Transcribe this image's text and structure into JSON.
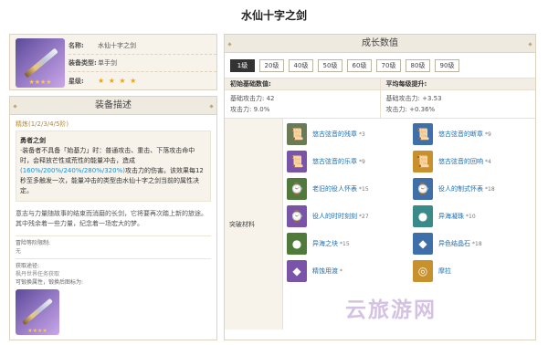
{
  "page": {
    "title": "水仙十字之剑"
  },
  "info": {
    "rows": [
      {
        "key": "名称:",
        "value": "水仙十字之剑"
      },
      {
        "key": "装备类型:",
        "value": "单手剑"
      },
      {
        "key": "星级:",
        "value": "★ ★ ★ ★"
      }
    ],
    "thumb_stars": "★★★★"
  },
  "desc": {
    "heading": "装备描述",
    "refine": "精炼(1/2/3/4/5阶)",
    "skill_name": "勇者之剑",
    "skill_text_1": "·装备者不具备「始基力」时：普通攻击、重击、下落攻击命中时，会释放芒性或荒性的能量冲击，造成",
    "skill_values": "(160%/200%/240%/280%/320%)",
    "skill_text_2": "攻击力的伤害。该效果每12秒至多触发一次，能量冲击的类型由水仙十字之剑当前的属性决定。",
    "flavor": "意志与力量随故事的结束而消磨的长剑，它将要再次踏上新的旅途。其中残余着一些力量，纪念着一场宏大的梦。",
    "fields": [
      {
        "label": "冒险等阶限制:",
        "value": "无"
      },
      {
        "label": "获取途径:",
        "value": "枫丹世界任务获取"
      },
      {
        "label": "可锻换属性，锻换后图标为:",
        "value": ""
      }
    ],
    "mini_stars": "★★★★"
  },
  "growth": {
    "heading": "成长数值",
    "levels": [
      "1级",
      "20级",
      "40级",
      "50级",
      "60级",
      "70级",
      "80级",
      "90级"
    ],
    "active_level": "1级",
    "initial_header": "初始基础数值:",
    "increase_header": "平均每级提升:",
    "initial": [
      "基础攻击力: 42",
      "攻击力: 9.0%"
    ],
    "increase": [
      "基础攻击力: +3.53",
      "攻击力: +0.36%"
    ],
    "materials_label": "突破材料",
    "materials": [
      {
        "name": "悠古弦音的残章",
        "count": "*3",
        "icon": "scroll-icon",
        "color": "#6b7a56"
      },
      {
        "name": "悠古弦音的断章",
        "count": "*9",
        "icon": "scroll-icon",
        "color": "#3f6fa8"
      },
      {
        "name": "悠古弦音的乐章",
        "count": "*9",
        "icon": "scroll-icon",
        "color": "#7a54a8"
      },
      {
        "name": "悠古弦音的回响",
        "count": "*4",
        "icon": "scroll-icon",
        "color": "#c9912e"
      },
      {
        "name": "老旧的役人怀表",
        "count": "*15",
        "icon": "watch-icon",
        "color": "#4f7a3a"
      },
      {
        "name": "役人的制式怀表",
        "count": "*18",
        "icon": "watch-icon",
        "color": "#3f6fa8"
      },
      {
        "name": "役人的时时刻刻",
        "count": "*27",
        "icon": "watch-icon",
        "color": "#7a54a8"
      },
      {
        "name": "异海凝珠",
        "count": "*10",
        "icon": "pearl-icon",
        "color": "#3a8a8a"
      },
      {
        "name": "异海之块",
        "count": "*15",
        "icon": "pearl-icon",
        "color": "#4f7a3a"
      },
      {
        "name": "异色结晶石",
        "count": "*18",
        "icon": "crystal-icon",
        "color": "#3f6fa8"
      },
      {
        "name": "精蚀用渡",
        "count": "*",
        "icon": "crystal-icon",
        "color": "#7a54a8"
      },
      {
        "name": "摩拉",
        "count": "",
        "icon": "coin-icon",
        "color": "#c9912e"
      }
    ]
  },
  "watermark": "云旅游网"
}
